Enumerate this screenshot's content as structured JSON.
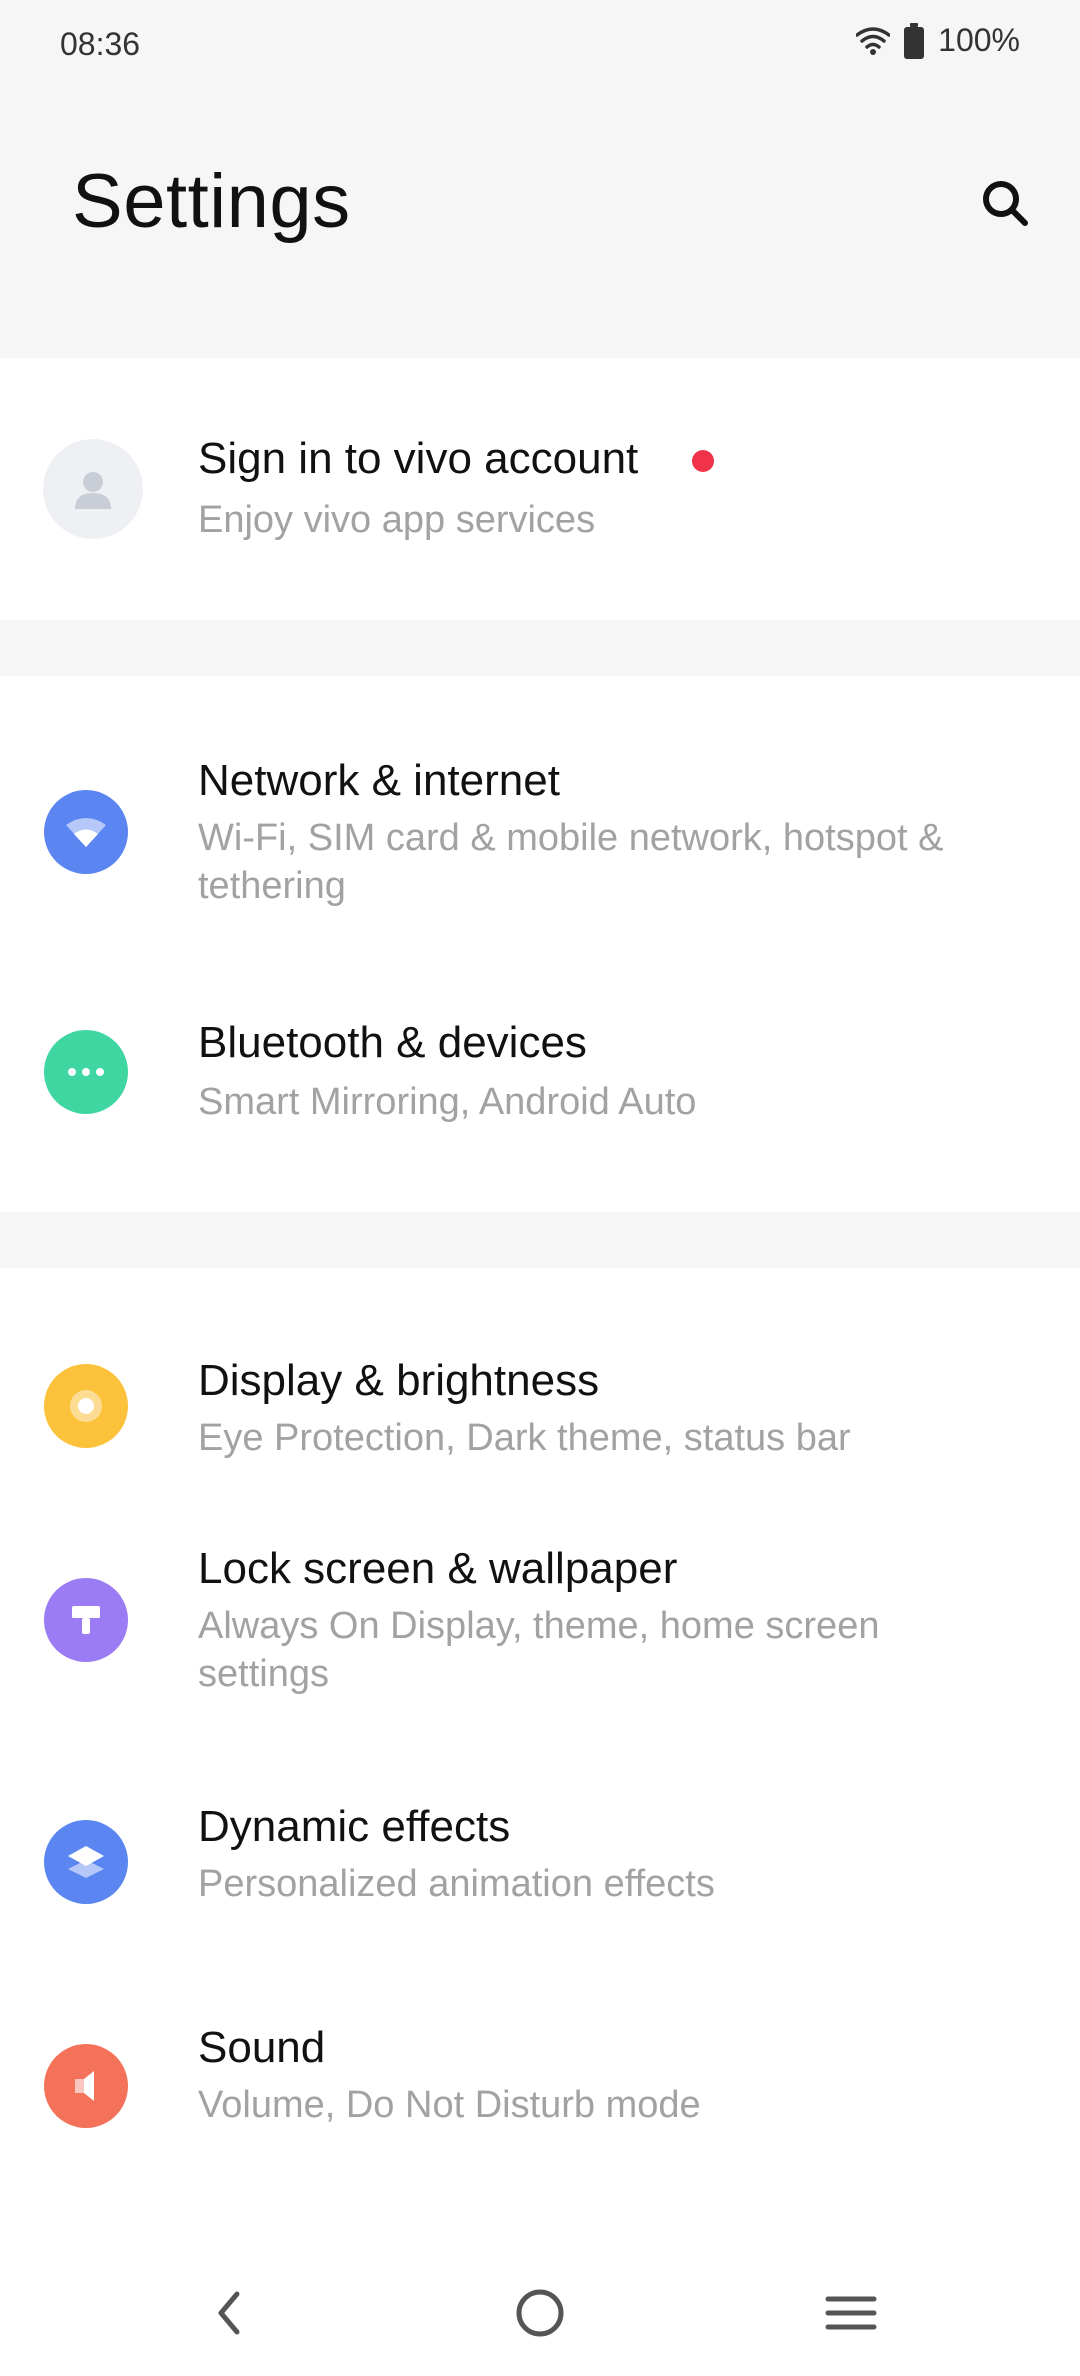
{
  "status_bar": {
    "time": "08:36",
    "battery_text": "100%",
    "icons": [
      "wifi-icon",
      "battery-icon"
    ]
  },
  "header": {
    "title": "Settings",
    "search_icon": "search-icon"
  },
  "account": {
    "title": "Sign in to vivo account",
    "subtitle": "Enjoy vivo app services",
    "icon": "avatar-icon",
    "has_notification_dot": true
  },
  "connectivity": [
    {
      "title": "Network & internet",
      "subtitle": "Wi-Fi, SIM card & mobile network, hotspot & tethering",
      "icon": "wifi-icon",
      "color": "#5b86f2"
    },
    {
      "title": "Bluetooth & devices",
      "subtitle": "Smart Mirroring, Android Auto",
      "icon": "bluetooth-dots-icon",
      "color": "#3fd6a1"
    }
  ],
  "display_group": [
    {
      "title": "Display & brightness",
      "subtitle": "Eye Protection, Dark theme, status bar",
      "icon": "brightness-icon",
      "color": "#fcc23c"
    },
    {
      "title": "Lock screen & wallpaper",
      "subtitle": "Always On Display, theme, home screen settings",
      "icon": "paint-roller-icon",
      "color": "#9b7cf4"
    },
    {
      "title": "Dynamic effects",
      "subtitle": "Personalized animation effects",
      "icon": "layers-icon",
      "color": "#5b86f2"
    },
    {
      "title": "Sound",
      "subtitle": "Volume, Do Not Disturb mode",
      "icon": "speaker-icon",
      "color": "#f4715a"
    }
  ],
  "nav_bar": {
    "icons": [
      "back-icon",
      "home-icon",
      "menu-icon"
    ]
  }
}
